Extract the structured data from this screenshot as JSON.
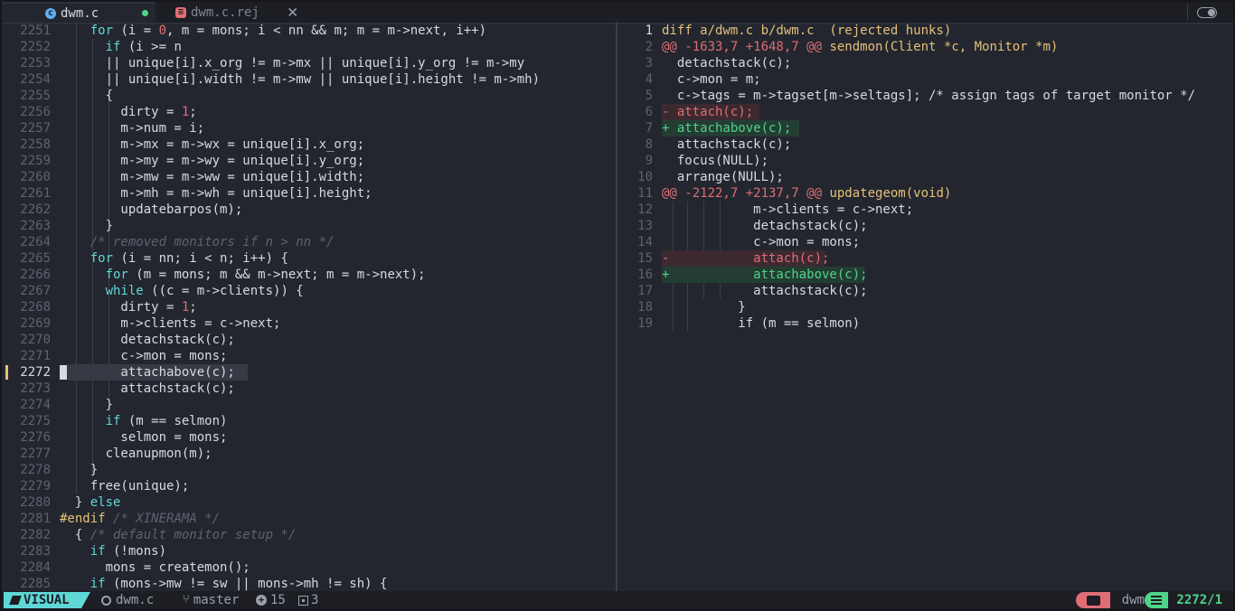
{
  "tabs": [
    {
      "name": "dwm.c",
      "icon": "c-file-icon",
      "modified": true
    },
    {
      "name": "dwm.c.rej",
      "icon": "reject-file-icon"
    }
  ],
  "colors": {
    "accent": "#5fd7d7",
    "added": "#50d38a",
    "removed": "#e06c75",
    "warning": "#e5c07b"
  },
  "left_pane": {
    "file": "dwm.c",
    "cursor_line": 2272,
    "lines": [
      {
        "n": "2251",
        "html": "    <span class=\"kw\">for</span> (i = <span class=\"num\">0</span>, m = mons; i &lt; nn &amp;&amp; m; m = m-&gt;next, i++)"
      },
      {
        "n": "2252",
        "html": "      <span class=\"kw\">if</span> (i &gt;= n"
      },
      {
        "n": "2253",
        "html": "      || unique[i].x_org != m-&gt;mx || unique[i].y_org != m-&gt;my"
      },
      {
        "n": "2254",
        "html": "      || unique[i].width != m-&gt;mw || unique[i].height != m-&gt;mh)"
      },
      {
        "n": "2255",
        "html": "      {"
      },
      {
        "n": "2256",
        "html": "        dirty = <span class=\"num\">1</span>;"
      },
      {
        "n": "2257",
        "html": "        m-&gt;num = i;"
      },
      {
        "n": "2258",
        "html": "        m-&gt;mx = m-&gt;wx = unique[i].x_org;"
      },
      {
        "n": "2259",
        "html": "        m-&gt;my = m-&gt;wy = unique[i].y_org;"
      },
      {
        "n": "2260",
        "html": "        m-&gt;mw = m-&gt;ww = unique[i].width;"
      },
      {
        "n": "2261",
        "html": "        m-&gt;mh = m-&gt;wh = unique[i].height;"
      },
      {
        "n": "2262",
        "html": "        updatebarpos(m);"
      },
      {
        "n": "2263",
        "html": "      }"
      },
      {
        "n": "2264",
        "html": "    <span class=\"cm\">/* removed monitors if n &gt; nn */</span>"
      },
      {
        "n": "2265",
        "html": "    <span class=\"kw\">for</span> (i = nn; i &lt; n; i++) {"
      },
      {
        "n": "2266",
        "html": "      <span class=\"kw\">for</span> (m = mons; m &amp;&amp; m-&gt;next; m = m-&gt;next);"
      },
      {
        "n": "2267",
        "html": "      <span class=\"kw\">while</span> ((c = m-&gt;clients)) {"
      },
      {
        "n": "2268",
        "html": "        dirty = <span class=\"num\">1</span>;"
      },
      {
        "n": "2269",
        "html": "        m-&gt;clients = c-&gt;next;"
      },
      {
        "n": "2270",
        "html": "        detachstack(c);"
      },
      {
        "n": "2271",
        "html": "        c-&gt;mon = mons;"
      },
      {
        "n": "2272",
        "html": "        attachabove(c);"
      },
      {
        "n": "2273",
        "html": "        attachstack(c);"
      },
      {
        "n": "2274",
        "html": "      }"
      },
      {
        "n": "2275",
        "html": "      <span class=\"kw\">if</span> (m == selmon)"
      },
      {
        "n": "2276",
        "html": "        selmon = mons;"
      },
      {
        "n": "2277",
        "html": "      cleanupmon(m);"
      },
      {
        "n": "2278",
        "html": "    }"
      },
      {
        "n": "2279",
        "html": "    free(unique);"
      },
      {
        "n": "2280",
        "html": "  } <span class=\"kw\">else</span>"
      },
      {
        "n": "2281",
        "html": "<span class=\"pp\">#endif</span> <span class=\"cm\">/* XINERAMA */</span>"
      },
      {
        "n": "2282",
        "html": "  { <span class=\"cm\">/* default monitor setup */</span>"
      },
      {
        "n": "2283",
        "html": "    <span class=\"kw\">if</span> (!mons)"
      },
      {
        "n": "2284",
        "html": "      mons = createmon();"
      },
      {
        "n": "2285",
        "html": "    <span class=\"kw\">if</span> (mons-&gt;mw != sw || mons-&gt;mh != sh) {"
      }
    ]
  },
  "right_pane": {
    "file": "dwm.c.rej",
    "lines": [
      {
        "n": "1",
        "kind": "header",
        "html": "<span class=\"hdr\">diff a/dwm.c b/dwm.c  (rejected hunks)</span>"
      },
      {
        "n": "2",
        "kind": "hunk",
        "html": "<span class=\"hunk\">@@ -1633,7 +1648,7 @@</span> <span class=\"hunkfn\">sendmon(Client *c, Monitor *m)</span>"
      },
      {
        "n": "3",
        "kind": "ctx",
        "html": "  detachstack(c);"
      },
      {
        "n": "4",
        "kind": "ctx",
        "html": "  c-&gt;mon = m;"
      },
      {
        "n": "5",
        "kind": "ctx",
        "html": "  c-&gt;tags = m-&gt;tagset[m-&gt;seltags]; /* assign tags of target monitor */"
      },
      {
        "n": "6",
        "kind": "del",
        "html": "<span class=\"del\">- attach(c);</span>"
      },
      {
        "n": "7",
        "kind": "add",
        "html": "<span class=\"add\">+ attachabove(c);</span>"
      },
      {
        "n": "8",
        "kind": "ctx",
        "html": "  attachstack(c);"
      },
      {
        "n": "9",
        "kind": "ctx",
        "html": "  focus(NULL);"
      },
      {
        "n": "10",
        "kind": "ctx",
        "html": "  arrange(NULL);"
      },
      {
        "n": "11",
        "kind": "hunk",
        "html": "<span class=\"hunk\">@@ -2122,7 +2137,7 @@</span> <span class=\"hunkfn\">updategeom(void)</span>"
      },
      {
        "n": "12",
        "kind": "ctx",
        "html": "            m-&gt;clients = c-&gt;next;"
      },
      {
        "n": "13",
        "kind": "ctx",
        "html": "            detachstack(c);"
      },
      {
        "n": "14",
        "kind": "ctx",
        "html": "            c-&gt;mon = mons;"
      },
      {
        "n": "15",
        "kind": "del",
        "html": "<span class=\"del\">-           attach(c);</span>"
      },
      {
        "n": "16",
        "kind": "add",
        "html": "<span class=\"add\">+           attachabove(c);</span>"
      },
      {
        "n": "17",
        "kind": "ctx",
        "html": "            attachstack(c);"
      },
      {
        "n": "18",
        "kind": "ctx",
        "html": "          }"
      },
      {
        "n": "19",
        "kind": "ctx",
        "html": "          if (m == selmon)"
      }
    ]
  },
  "statusline": {
    "mode": "VISUAL",
    "file": "dwm.c",
    "branch": "master",
    "git_added": "15",
    "buffers": "3",
    "project": "dwm",
    "position": "2272/1"
  }
}
